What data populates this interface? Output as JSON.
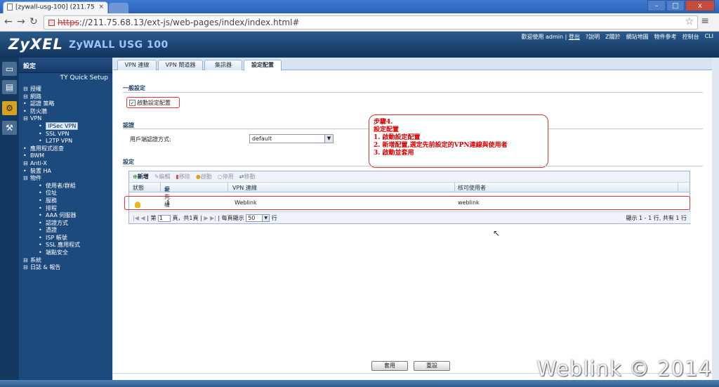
{
  "browser": {
    "tab_title": "[zywall-usg-100] (211.75",
    "tab_close": "×",
    "url_scheme": "https",
    "url_rest": "://211.75.68.13/ext-js/web-pages/index/index.html#",
    "win_min": "–",
    "win_max": "□",
    "win_close": "x"
  },
  "header": {
    "logo": "ZyXEL",
    "model": "ZyWALL USG 100",
    "welcome": "歡迎使用 admin",
    "logout": "登出",
    "help": "?說明",
    "about": "Z關於",
    "sitemap": "網站地圖",
    "objref": "物件參考",
    "console": "控制台",
    "cli": "CLI"
  },
  "sidebar": {
    "title": "設定",
    "quick_setup": "Quick Setup",
    "items": [
      {
        "m": "⊟",
        "label": "授權",
        "level": 0
      },
      {
        "m": "⊟",
        "label": "網路",
        "level": 0
      },
      {
        "m": "•",
        "label": "認證 策略",
        "level": 0
      },
      {
        "m": "•",
        "label": "防火牆",
        "level": 0
      },
      {
        "m": "⊟",
        "label": "VPN",
        "level": 0
      },
      {
        "m": "•",
        "label": "IPSec VPN",
        "level": 1,
        "selected": true
      },
      {
        "m": "•",
        "label": "SSL VPN",
        "level": 1
      },
      {
        "m": "•",
        "label": "L2TP VPN",
        "level": 1
      },
      {
        "m": "•",
        "label": "應用程式巡查",
        "level": 0
      },
      {
        "m": "•",
        "label": "BWM",
        "level": 0
      },
      {
        "m": "⊟",
        "label": "Anti-X",
        "level": 0
      },
      {
        "m": "•",
        "label": "裝置 HA",
        "level": 0
      },
      {
        "m": "⊟",
        "label": "物件",
        "level": 0
      },
      {
        "m": "•",
        "label": "使用者/群組",
        "level": 1
      },
      {
        "m": "•",
        "label": "位址",
        "level": 1
      },
      {
        "m": "•",
        "label": "服務",
        "level": 1
      },
      {
        "m": "•",
        "label": "排程",
        "level": 1
      },
      {
        "m": "•",
        "label": "AAA 伺服器",
        "level": 1
      },
      {
        "m": "•",
        "label": "認證方式",
        "level": 1
      },
      {
        "m": "•",
        "label": "憑證",
        "level": 1
      },
      {
        "m": "•",
        "label": "ISP 帳號",
        "level": 1
      },
      {
        "m": "•",
        "label": "SSL 應用程式",
        "level": 1
      },
      {
        "m": "•",
        "label": "端點安全",
        "level": 1
      },
      {
        "m": "⊟",
        "label": "系統",
        "level": 0
      },
      {
        "m": "⊟",
        "label": "日誌 & 報告",
        "level": 0
      }
    ]
  },
  "tabs": [
    "VPN 連線",
    "VPN 閘道器",
    "集訊器",
    "設定配置"
  ],
  "general": {
    "section": "一般設定",
    "enable_label": "啟動設定配置",
    "enable_checked": true
  },
  "auth": {
    "section": "認證",
    "client_auth_label": "用戶端認證方式:",
    "client_auth_value": "default"
  },
  "callout": {
    "lines": [
      "步驟4.",
      "設定配置",
      "1. 啟動設定配置",
      "2. 新增配置,選定先前設定的VPN連線與使用者",
      "3. 啟動並套用"
    ]
  },
  "settings": {
    "section": "設定",
    "toolbar": {
      "add": "新增",
      "edit": "編輯",
      "remove": "移除",
      "activate": "啟動",
      "deactivate": "停用",
      "move": "移動"
    },
    "columns": {
      "status": "狀態",
      "priority": "優先權",
      "vpn": "VPN 連線",
      "allowed": "核可使用者"
    },
    "rows": [
      {
        "priority": "1",
        "vpn": "Weblink",
        "allowed": "weblink"
      }
    ],
    "pager": {
      "page_label": "第",
      "page_value": "1",
      "page_total": "頁，共1頁",
      "per_page_label": "每頁顯示",
      "per_page_value": "50",
      "per_page_unit": "行",
      "info": "顯示 1 - 1 行, 共有 1 行"
    }
  },
  "buttons": {
    "apply": "套用",
    "reset": "重設"
  },
  "watermark": "Weblink © 2014"
}
